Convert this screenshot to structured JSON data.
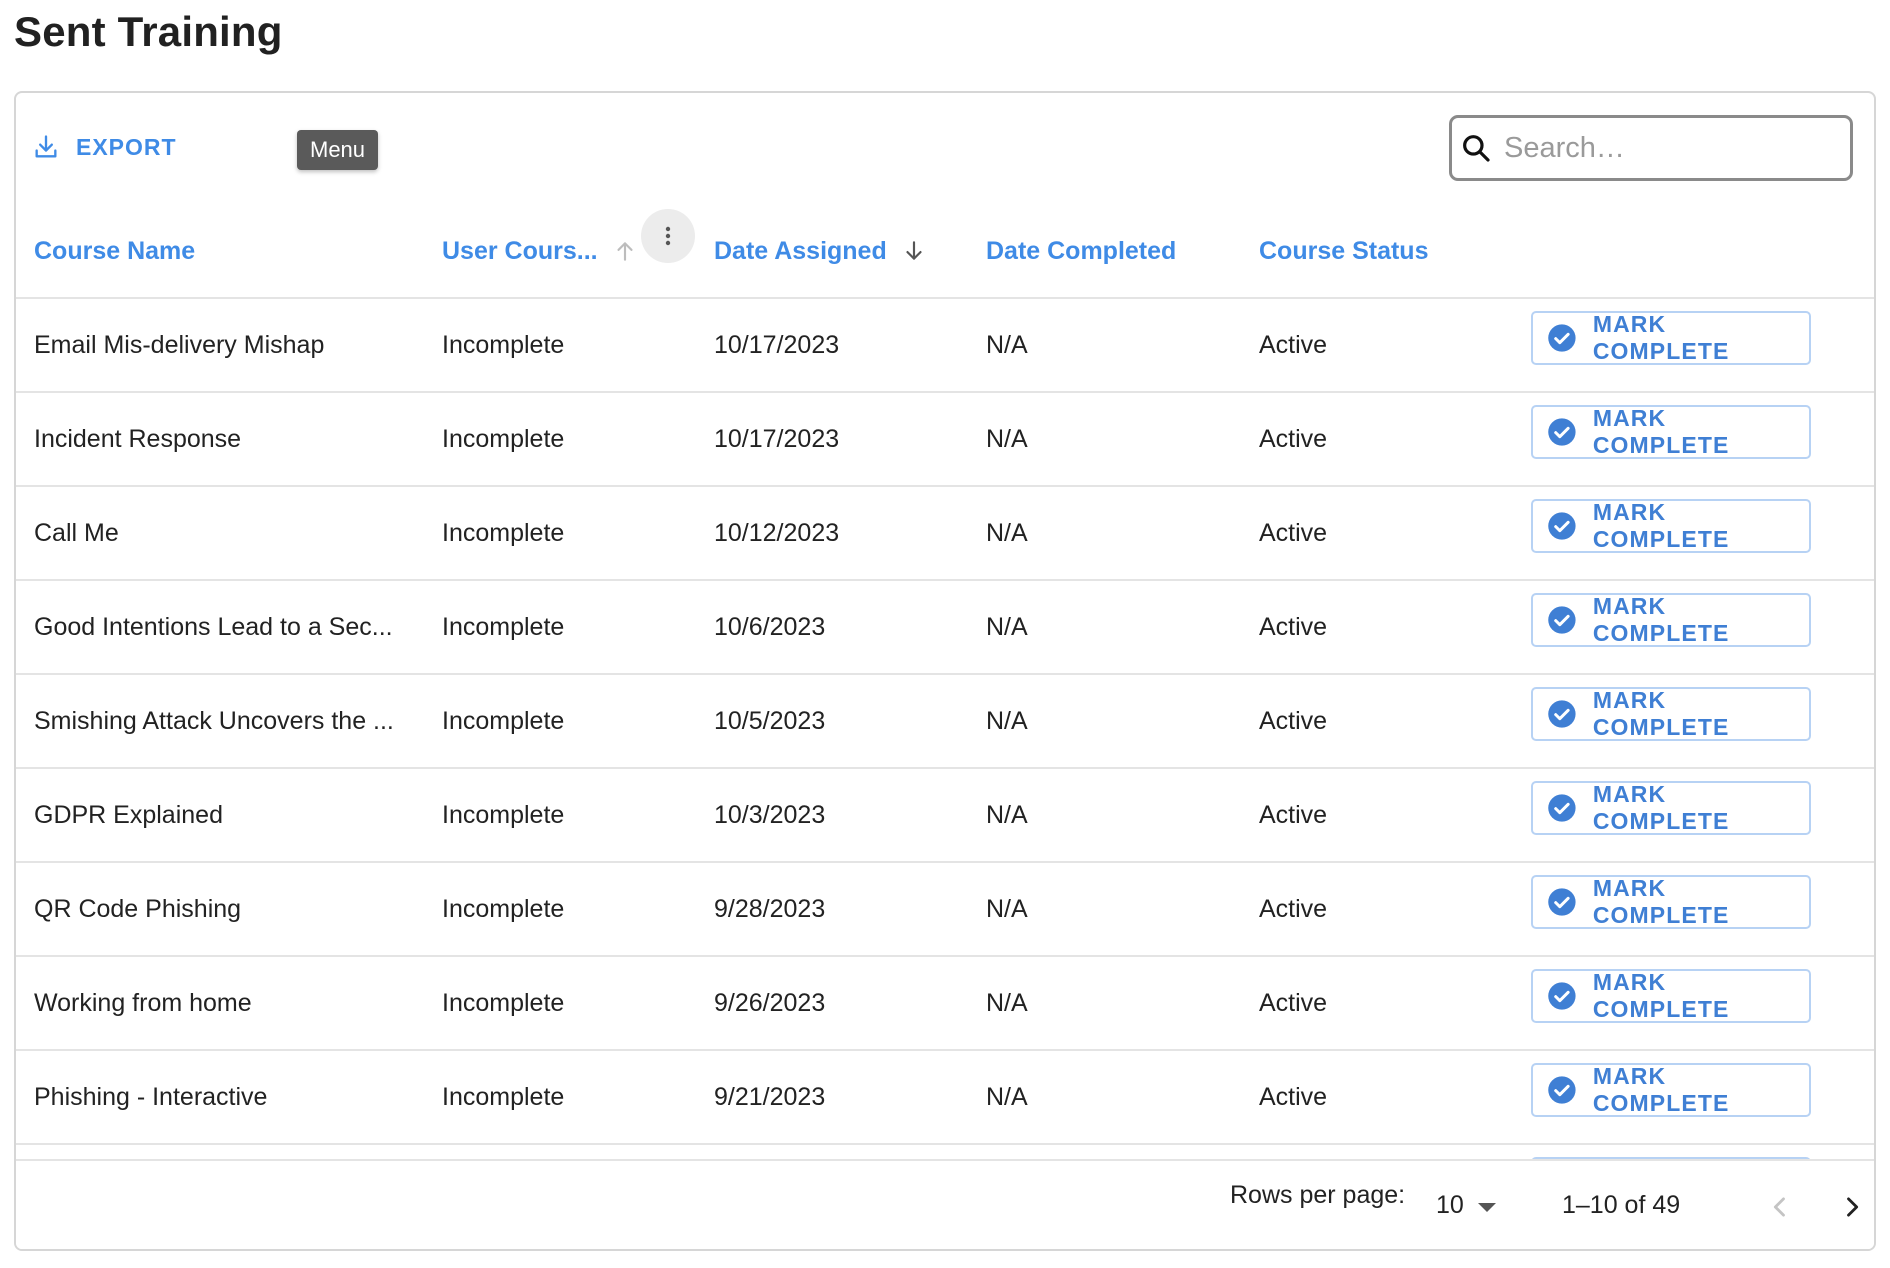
{
  "page": {
    "title": "Sent Training"
  },
  "toolbar": {
    "export_label": "EXPORT",
    "tooltip": "Menu",
    "search_placeholder": "Search…",
    "search_value": ""
  },
  "columns": {
    "course_name": "Course Name",
    "user_course_status": "User Cours...",
    "date_assigned": "Date Assigned",
    "date_completed": "Date Completed",
    "course_status": "Course Status"
  },
  "rows": [
    {
      "course": "Email Mis-delivery Mishap",
      "user_status": "Incomplete",
      "assigned": "10/17/2023",
      "completed": "N/A",
      "status": "Active",
      "action": "MARK COMPLETE"
    },
    {
      "course": "Incident Response",
      "user_status": "Incomplete",
      "assigned": "10/17/2023",
      "completed": "N/A",
      "status": "Active",
      "action": "MARK COMPLETE"
    },
    {
      "course": "Call Me",
      "user_status": "Incomplete",
      "assigned": "10/12/2023",
      "completed": "N/A",
      "status": "Active",
      "action": "MARK COMPLETE"
    },
    {
      "course": "Good Intentions Lead to a Sec...",
      "user_status": "Incomplete",
      "assigned": "10/6/2023",
      "completed": "N/A",
      "status": "Active",
      "action": "MARK COMPLETE"
    },
    {
      "course": "Smishing Attack Uncovers the ...",
      "user_status": "Incomplete",
      "assigned": "10/5/2023",
      "completed": "N/A",
      "status": "Active",
      "action": "MARK COMPLETE"
    },
    {
      "course": "GDPR Explained",
      "user_status": "Incomplete",
      "assigned": "10/3/2023",
      "completed": "N/A",
      "status": "Active",
      "action": "MARK COMPLETE"
    },
    {
      "course": "QR Code Phishing",
      "user_status": "Incomplete",
      "assigned": "9/28/2023",
      "completed": "N/A",
      "status": "Active",
      "action": "MARK COMPLETE"
    },
    {
      "course": "Working from home",
      "user_status": "Incomplete",
      "assigned": "9/26/2023",
      "completed": "N/A",
      "status": "Active",
      "action": "MARK COMPLETE"
    },
    {
      "course": "Phishing - Interactive",
      "user_status": "Incomplete",
      "assigned": "9/21/2023",
      "completed": "N/A",
      "status": "Active",
      "action": "MARK COMPLETE"
    },
    {
      "course": "",
      "user_status": "",
      "assigned": "",
      "completed": "",
      "status": "",
      "action": ""
    }
  ],
  "pagination": {
    "rows_per_page_label": "Rows per page:",
    "rows_per_page_value": "10",
    "range_text": "1–10 of 49"
  },
  "colors": {
    "accent": "#3f8be6",
    "button_text": "#3f7fd4",
    "button_border": "#b7d2f4",
    "tooltip_bg": "#5a5a5a"
  }
}
